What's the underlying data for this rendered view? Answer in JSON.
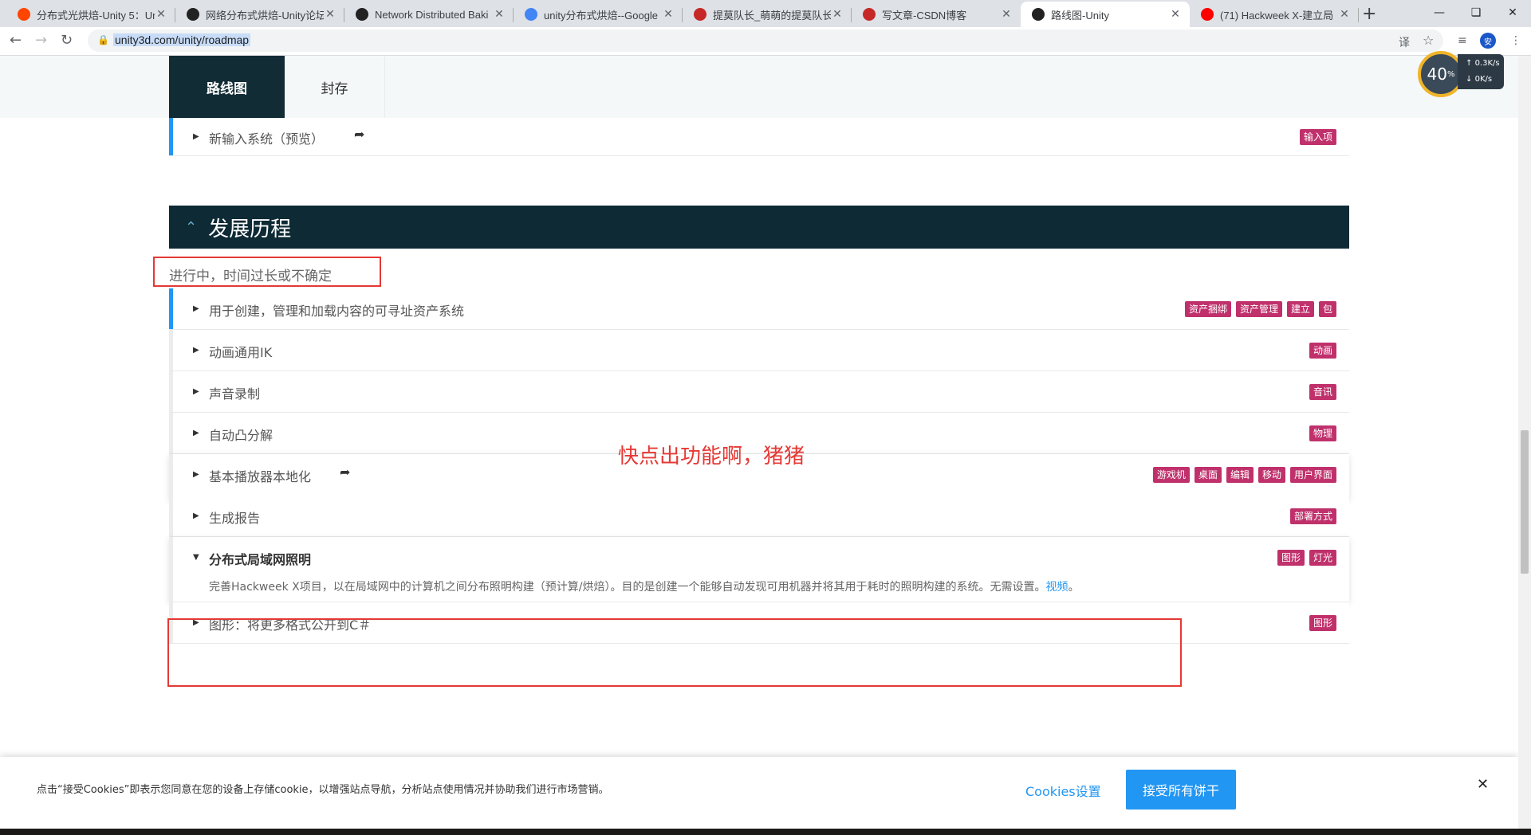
{
  "browser": {
    "tabs": [
      {
        "title": "分布式光烘焙-Unity 5：Un",
        "favicon_color": "#ff4500"
      },
      {
        "title": "网络分布式烘焙-Unity论坛",
        "favicon_color": "#222222"
      },
      {
        "title": "Network Distributed Baki",
        "favicon_color": "#222222"
      },
      {
        "title": "unity分布式烘焙--Google",
        "favicon_color": "#4285f4"
      },
      {
        "title": "提莫队长_萌萌的提莫队长_",
        "favicon_color": "#c62828"
      },
      {
        "title": "写文章-CSDN博客",
        "favicon_color": "#c62828"
      },
      {
        "title": "路线图-Unity",
        "favicon_color": "#222222"
      },
      {
        "title": "(71) Hackweek X-建立局",
        "favicon_color": "#ff0000"
      }
    ],
    "active_tab": 6,
    "url": "unity3d.com/unity/roadmap",
    "profile_initial": "安"
  },
  "speed_widget": {
    "percent": "40",
    "unit": "%",
    "up": "0.3",
    "down": "0",
    "rate_unit": "K/s"
  },
  "subnav": {
    "tab_roadmap": "路线图",
    "tab_archive": "封存"
  },
  "top_row": {
    "label": "新输入系统（预览）",
    "tags": [
      "输入项"
    ]
  },
  "section": {
    "title": "发展历程",
    "status": "进行中，时间过长或不确定"
  },
  "rows": [
    {
      "label": "用于创建，管理和加载内容的可寻址资产系统",
      "tags": [
        "资产捆绑",
        "资产管理",
        "建立",
        "包"
      ]
    },
    {
      "label": "动画通用IK",
      "tags": [
        "动画"
      ]
    },
    {
      "label": "声音录制",
      "tags": [
        "音讯"
      ]
    },
    {
      "label": "自动凸分解",
      "tags": [
        "物理"
      ]
    },
    {
      "label": "基本播放器本地化",
      "tags": [
        "游戏机",
        "桌面",
        "编辑",
        "移动",
        "用户界面"
      ]
    },
    {
      "label": "生成报告",
      "tags": [
        "部署方式"
      ]
    },
    {
      "label": "分布式局域网照明",
      "tags": [
        "图形",
        "灯光"
      ],
      "description": "完善Hackweek X项目，以在局域网中的计算机之间分布照明构建（预计算/烘焙）。目的是创建一个能够自动发现可用机器并将其用于耗时的照明构建的系统。无需设置。",
      "link": "视频",
      "trail": "。"
    },
    {
      "label": "图形：将更多格式公开到C＃",
      "tags": [
        "图形"
      ]
    }
  ],
  "annotation": "快点出功能啊，猪猪",
  "cookie": {
    "text": "点击“接受Cookies”即表示您同意在您的设备上存储cookie，以增强站点导航，分析站点使用情况并协助我们进行市场营销。",
    "settings": "Cookies设置",
    "accept": "接受所有饼干"
  },
  "colors": {
    "accent": "#2196f3",
    "tag": "#c0316c",
    "header": "#0d2a35",
    "annotation": "#e53935"
  }
}
